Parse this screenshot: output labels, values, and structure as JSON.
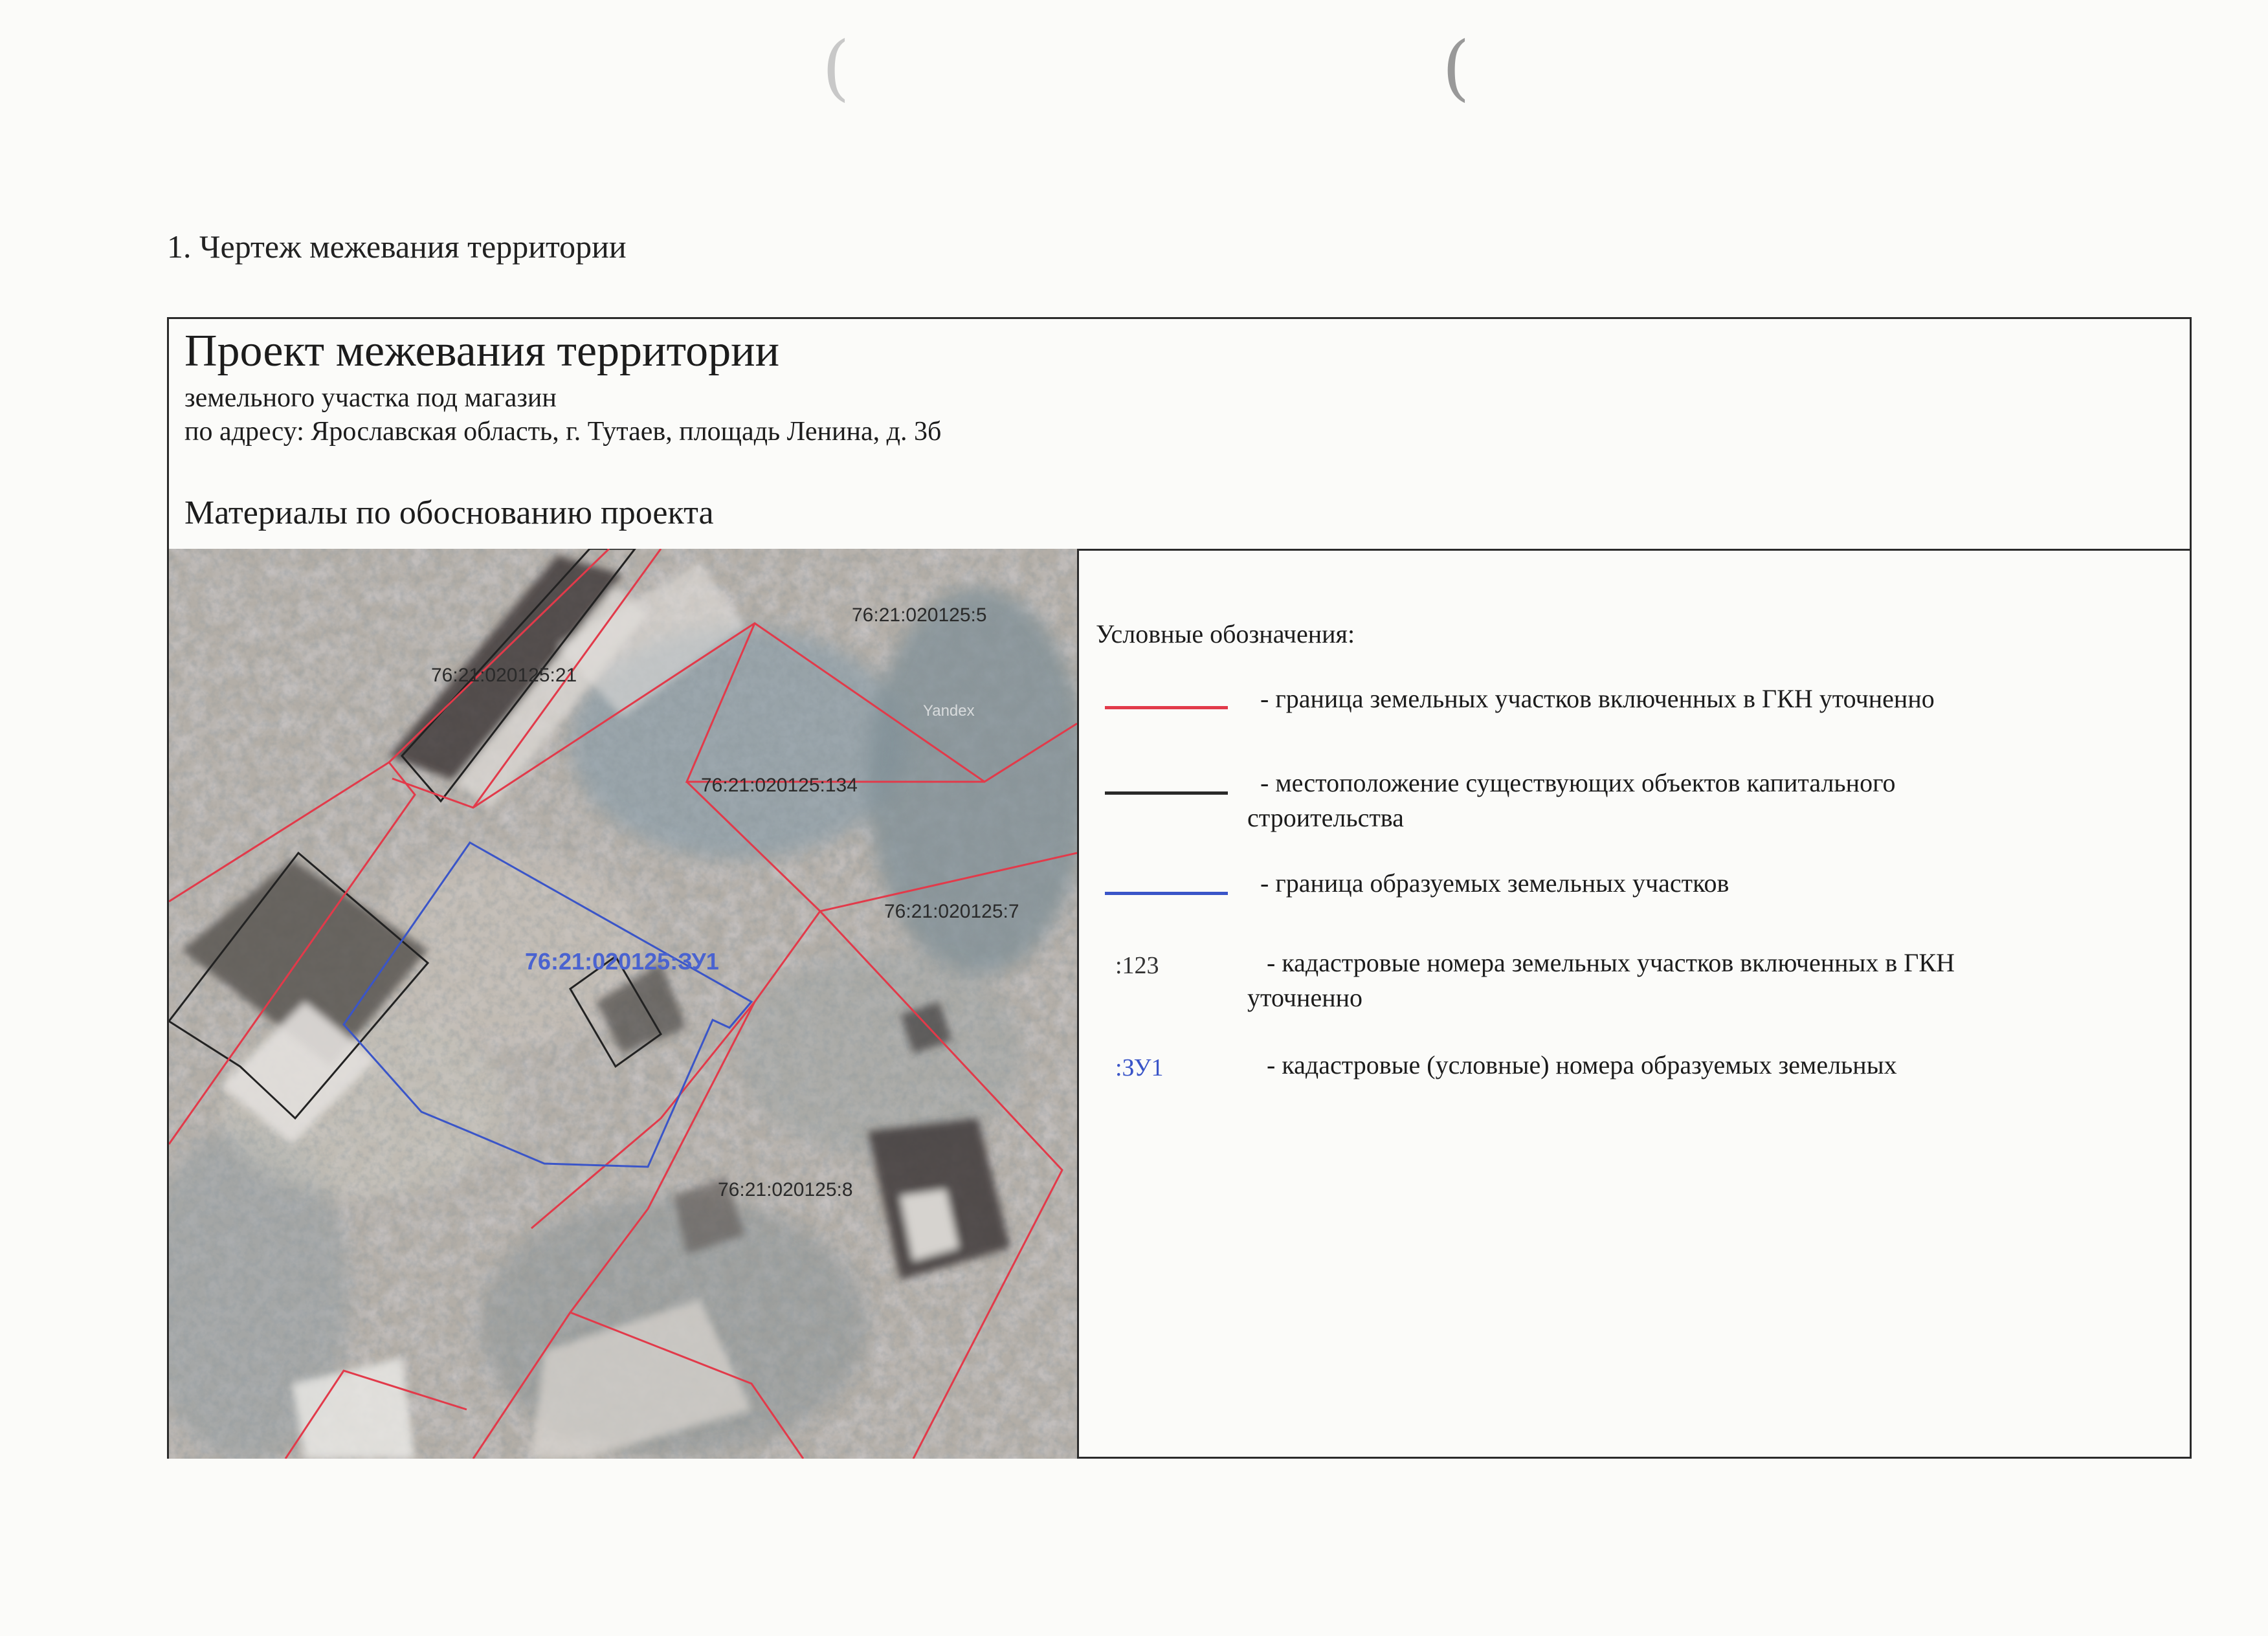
{
  "heading": "1. Чертеж межевания территории",
  "title_block": {
    "title": "Проект межевания территории",
    "subtitle_line1": "земельного участка под магазин",
    "subtitle_line2": "по адресу: Ярославская область, г. Тутаев, площадь Ленина, д. 3б",
    "materials": "Материалы по обоснованию проекта"
  },
  "map": {
    "parcels": [
      {
        "label": "76:21:020125:21"
      },
      {
        "label": "76:21:020125:5"
      },
      {
        "label": "76:21:020125:134"
      },
      {
        "label": "76:21:020125:7"
      },
      {
        "label": "76:21:020125:ЗУ1"
      },
      {
        "label": "76:21:020125:8"
      }
    ],
    "watermark": "Yandex",
    "colors": {
      "existing_boundary": "#e23a4a",
      "building_outline": "#222222",
      "new_boundary": "#3a55c8",
      "cadastre_label": "#2a2a2a",
      "new_label": "#4a63d0"
    }
  },
  "legend": {
    "title": "Условные обозначения:",
    "items": [
      {
        "line_color": "#e23a4a",
        "text": "- граница земельных участков включенных в ГКН уточненно"
      },
      {
        "line_color": "#2a2a2a",
        "text": "- местоположение существующих объектов капитального строительства"
      },
      {
        "line_color": "#3a55c8",
        "text": "- граница образуемых земельных участков"
      },
      {
        "code": ":123",
        "code_color": "#333333",
        "text": "- кадастровые номера земельных участков включенных в ГКН уточненно"
      },
      {
        "code": ":ЗУ1",
        "code_color": "#3a55c8",
        "text": "- кадастровые (условные) номера образуемых земельных"
      }
    ]
  },
  "margin_marks": [
    "(",
    "("
  ]
}
